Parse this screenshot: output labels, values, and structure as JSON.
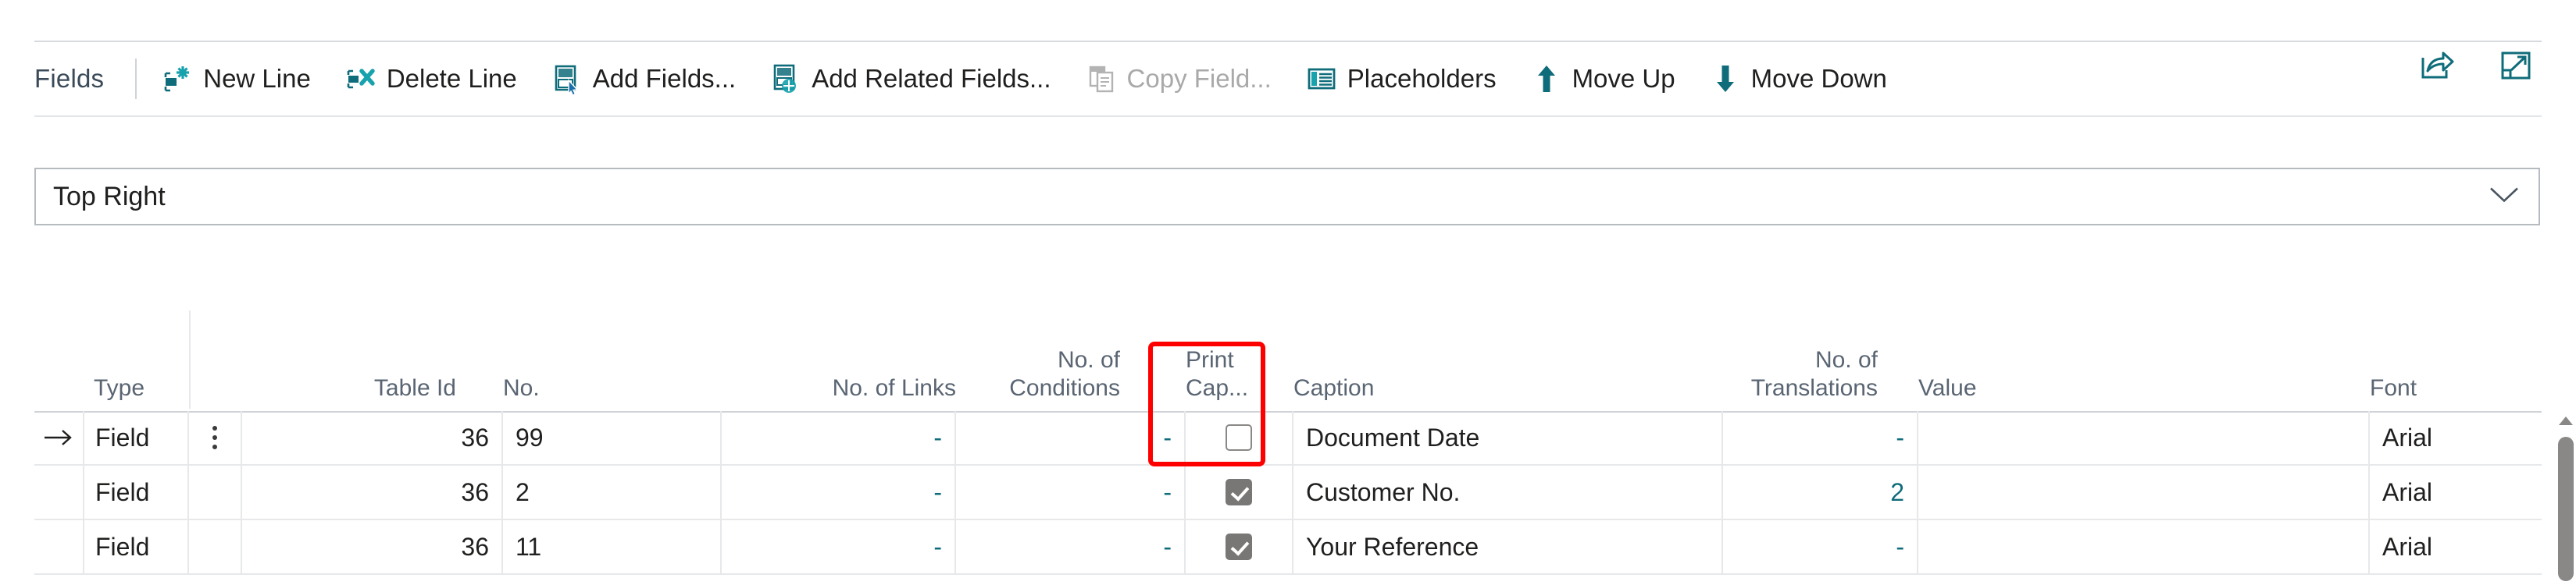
{
  "toolbar": {
    "title": "Fields",
    "buttons": [
      {
        "label": "New Line",
        "icon": "new-line-icon",
        "disabled": false
      },
      {
        "label": "Delete Line",
        "icon": "delete-line-icon",
        "disabled": false
      },
      {
        "label": "Add Fields...",
        "icon": "add-fields-icon",
        "disabled": false
      },
      {
        "label": "Add Related Fields...",
        "icon": "add-related-fields-icon",
        "disabled": false
      },
      {
        "label": "Copy Field...",
        "icon": "copy-field-icon",
        "disabled": true
      },
      {
        "label": "Placeholders",
        "icon": "placeholders-icon",
        "disabled": false
      },
      {
        "label": "Move Up",
        "icon": "arrow-up-icon",
        "disabled": false
      },
      {
        "label": "Move Down",
        "icon": "arrow-down-icon",
        "disabled": false
      }
    ],
    "right_icons": [
      {
        "name": "share-icon"
      },
      {
        "name": "open-in-new-window-icon"
      }
    ]
  },
  "section_selector": {
    "value": "Top Right",
    "chevron": "chevron-down-icon"
  },
  "table": {
    "columns": [
      "Type",
      "",
      "Table Id",
      "No.",
      "No. of Links",
      "No. of\nConditions",
      "Print\nCap...",
      "Caption",
      "No. of\nTranslations",
      "Value",
      "Font"
    ],
    "headers": {
      "type": "Type",
      "table_id": "Table Id",
      "no": "No.",
      "no_of_links": "No. of Links",
      "no_of_conditions_l1": "No. of",
      "no_of_conditions_l2": "Conditions",
      "print_cap_l1": "Print",
      "print_cap_l2": "Cap...",
      "caption": "Caption",
      "no_of_translations_l1": "No. of",
      "no_of_translations_l2": "Translations",
      "value": "Value",
      "font": "Font"
    },
    "rows": [
      {
        "selected": true,
        "type": "Field",
        "table_id": "36",
        "no": "99",
        "no_of_links": "-",
        "no_of_conditions": "-",
        "print_caption": false,
        "caption": "Document Date",
        "no_of_translations": "-",
        "value": "",
        "font": "Arial"
      },
      {
        "selected": false,
        "type": "Field",
        "table_id": "36",
        "no": "2",
        "no_of_links": "-",
        "no_of_conditions": "-",
        "print_caption": true,
        "caption": "Customer No.",
        "no_of_translations": "2",
        "value": "",
        "font": "Arial"
      },
      {
        "selected": false,
        "type": "Field",
        "table_id": "36",
        "no": "11",
        "no_of_links": "-",
        "no_of_conditions": "-",
        "print_caption": true,
        "caption": "Your Reference",
        "no_of_translations": "-",
        "value": "",
        "font": "Arial"
      }
    ]
  },
  "annotation": {
    "highlight_column": "Print Cap...",
    "color": "#ff0000"
  },
  "colors": {
    "accent": "#0f6c7a",
    "header_text": "#5a6573",
    "border": "#e6e8ea",
    "highlight": "#ff0000"
  }
}
